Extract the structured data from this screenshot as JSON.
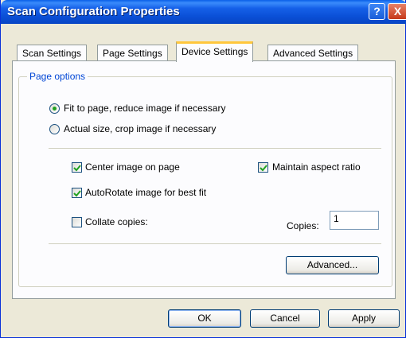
{
  "window": {
    "title": "Scan Configuration Properties"
  },
  "titlebar_buttons": {
    "help": "?",
    "close": "X"
  },
  "tabs": [
    {
      "label": "Scan Settings",
      "active": false
    },
    {
      "label": "Page Settings",
      "active": false
    },
    {
      "label": "Device Settings",
      "active": true
    },
    {
      "label": "Advanced Settings",
      "active": false
    }
  ],
  "page_options": {
    "group_label": "Page options",
    "fit_to_page": {
      "label": "Fit to page, reduce image if necessary",
      "selected": true
    },
    "actual_size": {
      "label": "Actual size, crop image if necessary",
      "selected": false
    },
    "center_image": {
      "label": "Center image on page",
      "checked": true
    },
    "maintain_aspect": {
      "label": "Maintain aspect ratio",
      "checked": true
    },
    "autorotate": {
      "label": "AutoRotate image for best fit",
      "checked": true
    },
    "collate": {
      "label": "Collate copies:",
      "checked": false
    },
    "copies": {
      "label": "Copies:",
      "value": "1"
    },
    "advanced_button": "Advanced..."
  },
  "footer": {
    "ok": "OK",
    "cancel": "Cancel",
    "apply": "Apply"
  },
  "colors": {
    "titlebar": "#0a4fd6",
    "group_label": "#0046d5",
    "active_tab_accent": "#ffc73c",
    "radio_dot": "#21a121"
  }
}
